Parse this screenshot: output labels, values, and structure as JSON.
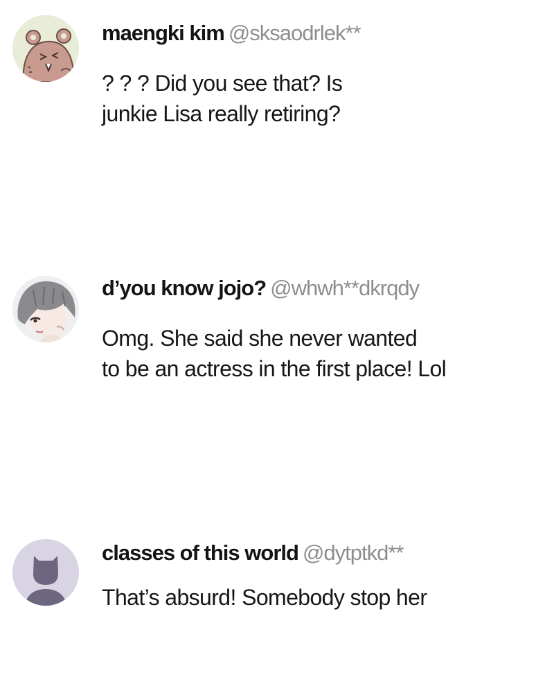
{
  "comments": [
    {
      "name": "maengki kim",
      "handle": "@sksaodrlek**",
      "avatar_icon": "bear-avatar-icon",
      "lines": [
        "? ? ?  Did you see that?  Is",
        "junkie Lisa really retiring?"
      ]
    },
    {
      "name": "d’you know jojo?",
      "handle": "@whwh**dkrqdy",
      "avatar_icon": "boy-avatar-icon",
      "lines": [
        "Omg. She said she never wanted",
        "to be an actress in the first place!  Lol"
      ]
    },
    {
      "name": "classes of this world",
      "handle": "@dytptkd**",
      "avatar_icon": "default-user-avatar-icon",
      "lines": [
        "That’s absurd!  Somebody stop her"
      ]
    }
  ],
  "colors": {
    "handle": "#8e8e8e",
    "bear_avatar_bg": "#e9ecd6",
    "bear_face": "#c89a90",
    "boy_avatar_bg": "#e6e6e6",
    "default_avatar_bg": "#d8d4e3",
    "default_avatar_figure": "#6d6680"
  }
}
